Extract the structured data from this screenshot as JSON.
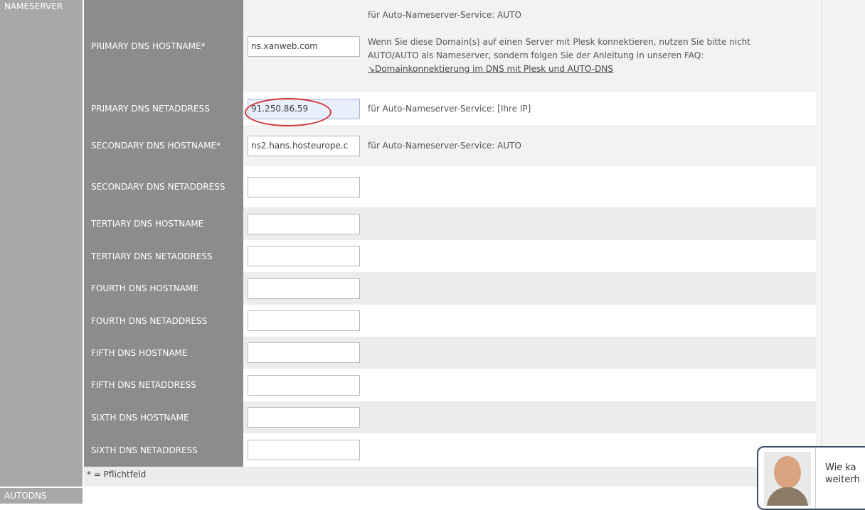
{
  "sections": {
    "nameserver": "NAMESERVER",
    "autodns": "AUTODNS"
  },
  "rows": [
    {
      "label": "PRIMARY DNS HOSTNAME*",
      "value": "ns.xanweb.com",
      "note_lines": [
        "für Auto-Nameserver-Service: AUTO",
        "",
        "Wenn Sie diese Domain(s) auf einen Server mit Plesk konnektieren, nutzen Sie bitte nicht",
        "AUTO/AUTO als Nameserver, sondern folgen Sie der Anleitung in unseren FAQ:"
      ],
      "note_link": "↘Domainkonnektierung im DNS mit Plesk und AUTO-DNS"
    },
    {
      "label": "PRIMARY DNS NETADDRESS",
      "value": "91.250.86.59",
      "note": "für Auto-Nameserver-Service: [Ihre IP]"
    },
    {
      "label": "SECONDARY DNS HOSTNAME*",
      "value": "ns2.hans.hosteurope.c",
      "note": "für Auto-Nameserver-Service: AUTO"
    },
    {
      "label": "SECONDARY DNS NETADDRESS",
      "value": "",
      "note": ""
    },
    {
      "label": "TERTIARY DNS HOSTNAME",
      "value": "",
      "note": ""
    },
    {
      "label": "TERTIARY DNS NETADDRESS",
      "value": "",
      "note": ""
    },
    {
      "label": "FOURTH DNS HOSTNAME",
      "value": "",
      "note": ""
    },
    {
      "label": "FOURTH DNS NETADDRESS",
      "value": "",
      "note": ""
    },
    {
      "label": "FIFTH DNS HOSTNAME",
      "value": "",
      "note": ""
    },
    {
      "label": "FIFTH DNS NETADDRESS",
      "value": "",
      "note": ""
    },
    {
      "label": "SIXTH DNS HOSTNAME",
      "value": "",
      "note": ""
    },
    {
      "label": "SIXTH DNS NETADDRESS",
      "value": "",
      "note": ""
    }
  ],
  "footer": "* = Pflichtfeld",
  "chat": {
    "line1": "Wie ka",
    "line2": "weiterh"
  },
  "colors": {
    "highlight_circle": "#d23434",
    "label_bg": "#8c8c8c",
    "section_bg": "#a8a8a8"
  }
}
